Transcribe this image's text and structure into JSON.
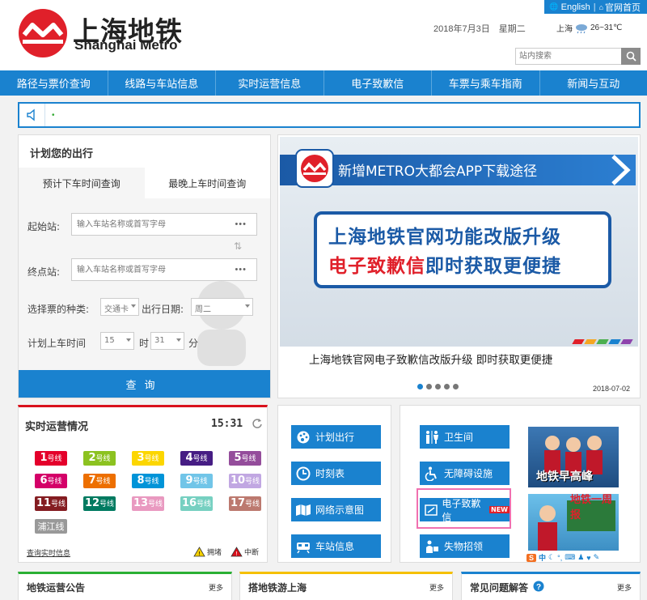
{
  "header": {
    "logo_cn": "上海地铁",
    "logo_en": "Shanghai Metro",
    "top_links": [
      "English",
      "官网首页"
    ],
    "date": "2018年7月3日",
    "weekday": "星期二",
    "weather_city": "上海",
    "weather_temp": "26~31℃",
    "search_placeholder": "站内搜索"
  },
  "nav": [
    "路径与票价查询",
    "线路与车站信息",
    "实时运营信息",
    "电子致歉信",
    "车票与乘车指南",
    "新闻与互动"
  ],
  "notice": {
    "marker": "•"
  },
  "planner": {
    "title": "计划您的出行",
    "tabs": [
      "预计下车时间查询",
      "最晚上车时间查询"
    ],
    "start_label": "起始站:",
    "end_label": "终点站:",
    "station_placeholder": "输入车站名称或首写字母",
    "more": "•••",
    "swap": "⇅",
    "ticket_label": "选择票的种类:",
    "ticket_value": "交通卡",
    "date_label": "出行日期:",
    "date_value": "周二",
    "time_label": "计划上车时间",
    "hour_value": "15",
    "hour_unit": "时",
    "minute_value": "31",
    "minute_unit": "分",
    "query_button": "查询"
  },
  "banner": {
    "ribbon_text": "新增METRO大都会APP下载途径",
    "board_line1": "上海地铁官网功能改版升级",
    "board_line2_red": "电子致歉信",
    "board_line2_blue": "即时获取更便捷",
    "caption": "上海地铁官网电子致歉信改版升级  即时获取更便捷",
    "date": "2018-07-02",
    "dots": 5,
    "active_dot": 0,
    "stripe_colors": [
      "#e0202a",
      "#f5a623",
      "#4caf50",
      "#1a82cf",
      "#8e44ad"
    ]
  },
  "realtime": {
    "title": "实时运营情况",
    "time": "15:31",
    "unit": "号线",
    "lines": [
      {
        "num": "1",
        "color": "#e4002b"
      },
      {
        "num": "2",
        "color": "#8cc220"
      },
      {
        "num": "3",
        "color": "#fcd600"
      },
      {
        "num": "4",
        "color": "#461d84"
      },
      {
        "num": "5",
        "color": "#944d9b"
      },
      {
        "num": "6",
        "color": "#d40068"
      },
      {
        "num": "7",
        "color": "#ed6f00"
      },
      {
        "num": "8",
        "color": "#0094d8"
      },
      {
        "num": "9",
        "color": "#71c5e8"
      },
      {
        "num": "10",
        "color": "#c1a7e2"
      },
      {
        "num": "11",
        "color": "#841c21"
      },
      {
        "num": "12",
        "color": "#007a60"
      },
      {
        "num": "13",
        "color": "#e999c0"
      },
      {
        "num": "16",
        "color": "#76d0c1"
      },
      {
        "num": "17",
        "color": "#bc796f"
      }
    ],
    "pujiang": {
      "label": "浦江线",
      "color": "#999999"
    },
    "link": "查询实时信息",
    "legend": [
      "拥堵",
      "中断"
    ]
  },
  "services_left": [
    "计划出行",
    "时刻表",
    "网络示意图",
    "车站信息"
  ],
  "services_right": [
    "卫生间",
    "无障碍设施",
    "电子致歉信",
    "失物招领"
  ],
  "new_tag": "NEW",
  "promos": [
    "地铁早高峰",
    "地铁一周报"
  ],
  "ime_label": "中",
  "bottom": [
    {
      "title": "地铁运营公告",
      "more": "更多",
      "color": "#2ab034"
    },
    {
      "title": "搭地铁游上海",
      "more": "更多",
      "color": "#f5c000"
    },
    {
      "title": "常见问题解答",
      "more": "更多",
      "color": "#1a82cf"
    }
  ]
}
